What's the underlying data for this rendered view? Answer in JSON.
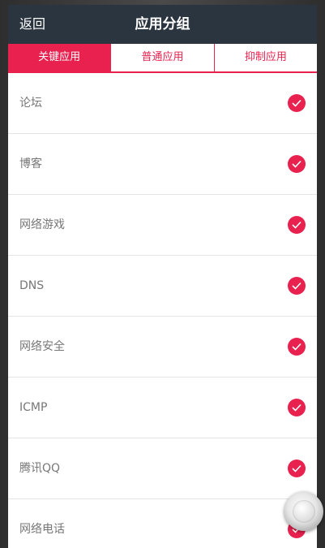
{
  "header": {
    "back_label": "返回",
    "title": "应用分组"
  },
  "tabs": [
    {
      "label": "关键应用",
      "active": true
    },
    {
      "label": "普通应用",
      "active": false
    },
    {
      "label": "抑制应用",
      "active": false
    }
  ],
  "apps": [
    {
      "label": "论坛",
      "checked": true
    },
    {
      "label": "博客",
      "checked": true
    },
    {
      "label": "网络游戏",
      "checked": true
    },
    {
      "label": "DNS",
      "checked": true
    },
    {
      "label": "网络安全",
      "checked": true
    },
    {
      "label": "ICMP",
      "checked": true
    },
    {
      "label": "腾讯QQ",
      "checked": true
    },
    {
      "label": "网络电话",
      "checked": true
    }
  ],
  "colors": {
    "accent": "#e8214f",
    "topbar": "#2b3540"
  },
  "icons": {
    "check": "check-circle-icon",
    "floating": "assistive-touch-icon"
  }
}
